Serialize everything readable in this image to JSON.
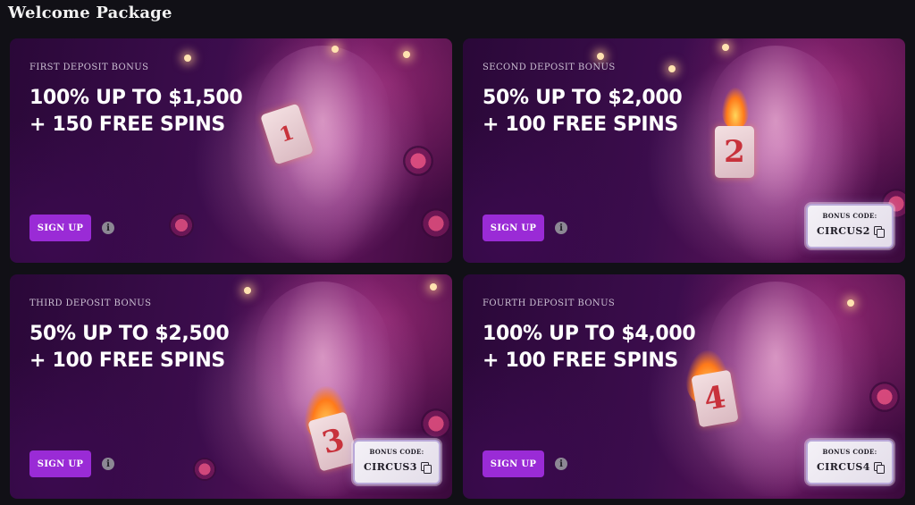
{
  "page": {
    "title": "Welcome Package"
  },
  "cards": [
    {
      "label": "FIRST DEPOSIT BONUS",
      "headline_line1": "100% UP TO $1,500",
      "headline_line2": "+ 150 FREE SPINS",
      "signup_label": "SIGN UP",
      "info_icon": "info-icon",
      "number": "1"
    },
    {
      "label": "SECOND DEPOSIT BONUS",
      "headline_line1": "50% UP TO $2,000",
      "headline_line2": "+ 100 FREE SPINS",
      "signup_label": "SIGN UP",
      "info_icon": "info-icon",
      "number": "2",
      "bonus_code_label": "BONUS CODE:",
      "bonus_code": "CIRCUS2"
    },
    {
      "label": "THIRD DEPOSIT BONUS",
      "headline_line1": "50% UP TO $2,500",
      "headline_line2": "+ 100 FREE SPINS",
      "signup_label": "SIGN UP",
      "info_icon": "info-icon",
      "number": "3",
      "bonus_code_label": "BONUS CODE:",
      "bonus_code": "CIRCUS3"
    },
    {
      "label": "FOURTH DEPOSIT BONUS",
      "headline_line1": "100% UP TO $4,000",
      "headline_line2": "+ 100 FREE SPINS",
      "signup_label": "SIGN UP",
      "info_icon": "info-icon",
      "number": "4",
      "bonus_code_label": "BONUS CODE:",
      "bonus_code": "CIRCUS4"
    }
  ],
  "colors": {
    "page_background": "#111016",
    "signup_button": "#9a2bd6",
    "card_base": "#3c0d4d"
  }
}
